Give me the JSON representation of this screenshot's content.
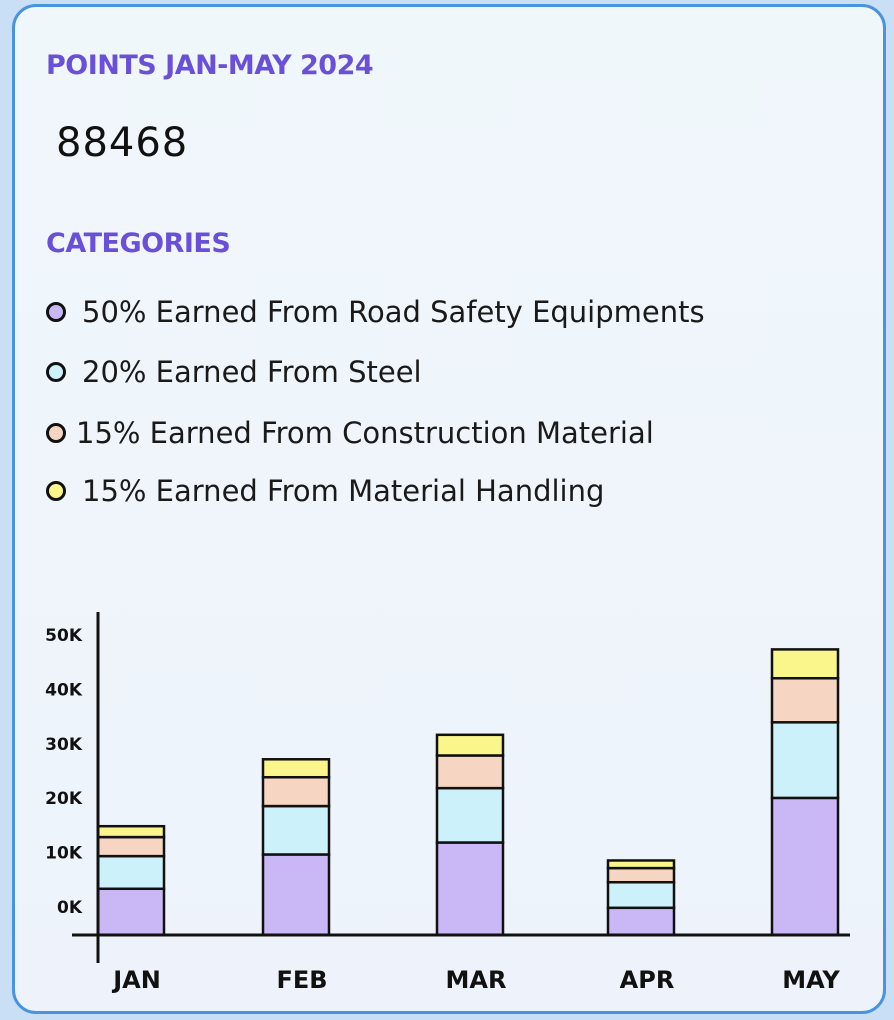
{
  "header": {
    "title": "POINTS JAN-MAY 2024",
    "total": "88468",
    "categories_heading": "CATEGORIES"
  },
  "legend": [
    {
      "label": "50% Earned From Road Safety Equipments",
      "color": "#c9b8f5"
    },
    {
      "label": "20% Earned From Steel",
      "color": "#cdf1fa"
    },
    {
      "label": "15% Earned From Construction Material",
      "color": "#f6d5c2"
    },
    {
      "label": "15% Earned From Material Handling",
      "color": "#fbf68c"
    }
  ],
  "chart_data": {
    "type": "bar",
    "stacked": true,
    "categories": [
      "JAN",
      "FEB",
      "MAR",
      "APR",
      "MAY"
    ],
    "y_tick_labels": [
      "0K",
      "10K",
      "20K",
      "30K",
      "40K",
      "50K"
    ],
    "ylim": [
      -5000,
      55000
    ],
    "series": [
      {
        "name": "50% Earned From Road Safety Equipments",
        "color": "#c9b8f5",
        "values": [
          8500,
          14800,
          17000,
          5000,
          25200
        ]
      },
      {
        "name": "20% Earned From Steel",
        "color": "#cdf1fa",
        "values": [
          6000,
          8900,
          10000,
          4700,
          13900
        ]
      },
      {
        "name": "15% Earned From Construction Material",
        "color": "#f6d5c2",
        "values": [
          3500,
          5300,
          6000,
          2600,
          8100
        ]
      },
      {
        "name": "15% Earned From Material Handling",
        "color": "#fbf68c",
        "values": [
          2000,
          3300,
          3800,
          1400,
          5300
        ]
      }
    ],
    "grid": false
  }
}
